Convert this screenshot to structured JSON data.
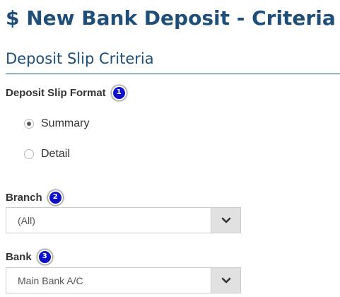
{
  "page": {
    "title": "$ New Bank Deposit - Criteria"
  },
  "section": {
    "title": "Deposit Slip Criteria"
  },
  "deposit_slip_format": {
    "label": "Deposit Slip Format",
    "badge": "1",
    "options": [
      {
        "label": "Summary",
        "selected": true
      },
      {
        "label": "Detail",
        "selected": false
      }
    ]
  },
  "branch": {
    "label": "Branch",
    "badge": "2",
    "value": "(All)",
    "icon": "chevron-down-icon"
  },
  "bank": {
    "label": "Bank",
    "badge": "3",
    "value": "Main Bank A/C",
    "icon": "chevron-down-icon"
  },
  "colors": {
    "heading": "#1f4e79",
    "badge": "#1010c8",
    "dropdown_button": "#e1e1e1"
  }
}
